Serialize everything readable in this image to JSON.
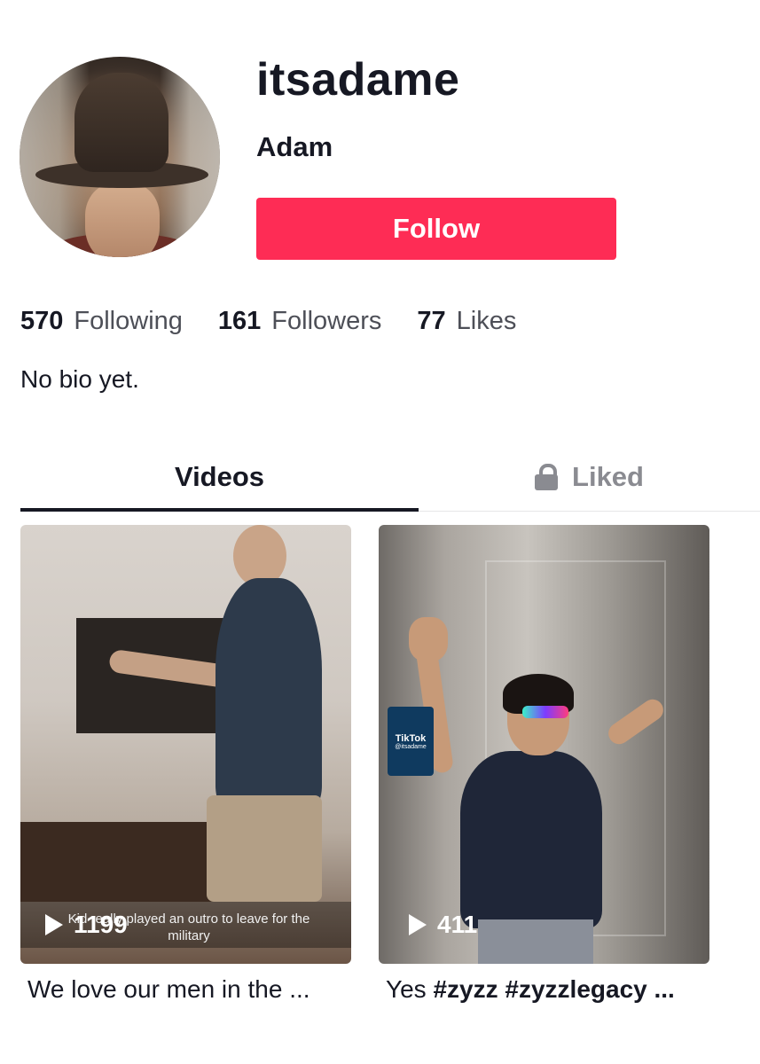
{
  "profile": {
    "username": "itsadame",
    "nickname": "Adam",
    "follow_label": "Follow",
    "bio": "No bio yet."
  },
  "stats": {
    "following_count": "570",
    "following_label": "Following",
    "followers_count": "161",
    "followers_label": "Followers",
    "likes_count": "77",
    "likes_label": "Likes"
  },
  "tabs": {
    "videos_label": "Videos",
    "liked_label": "Liked"
  },
  "videos": [
    {
      "views": "1199",
      "overlay_text": "Kid really played an outro to leave for the military",
      "description_plain": "We love our men in the ..."
    },
    {
      "views": "411",
      "sticker_title": "TikTok",
      "sticker_handle": "@itsadame",
      "description_plain": "Yes ",
      "description_tags": "#zyzz #zyzzlegacy ..."
    }
  ],
  "colors": {
    "follow_button": "#fe2c55",
    "text_primary": "#161823",
    "text_secondary": "#8a8b91"
  },
  "icons": {
    "lock": "lock-icon",
    "play": "play-icon"
  }
}
